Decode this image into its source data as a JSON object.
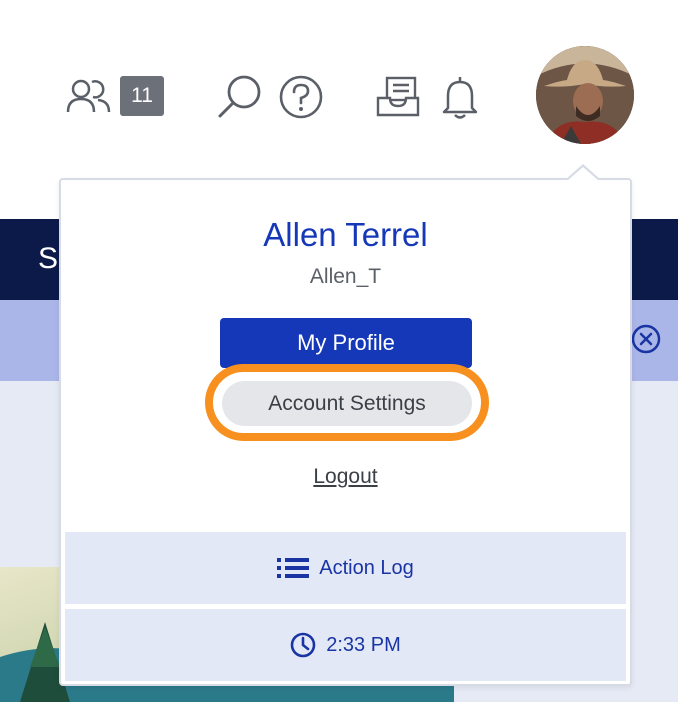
{
  "topbar": {
    "users_icon": "users-icon",
    "users_count": "11",
    "search_icon": "search-icon",
    "help_icon": "help-icon",
    "inbox_icon": "inbox-icon",
    "notifications_icon": "bell-icon",
    "avatar": "user-avatar"
  },
  "background": {
    "navbar_text": "S",
    "close_icon": "close-circle-icon"
  },
  "menu": {
    "name": "Allen Terrel",
    "username": "Allen_T",
    "my_profile_label": "My Profile",
    "account_settings_label": "Account Settings",
    "logout_label": "Logout",
    "action_log_label": "Action Log",
    "action_log_icon": "list-icon",
    "time_label": "2:33 PM",
    "time_icon": "clock-icon"
  },
  "colors": {
    "primary": "#1538b8",
    "highlight": "#f7901e",
    "navbar": "#0c1a4a",
    "banner": "#aab6e8",
    "row_bg": "#e3e8f7"
  }
}
